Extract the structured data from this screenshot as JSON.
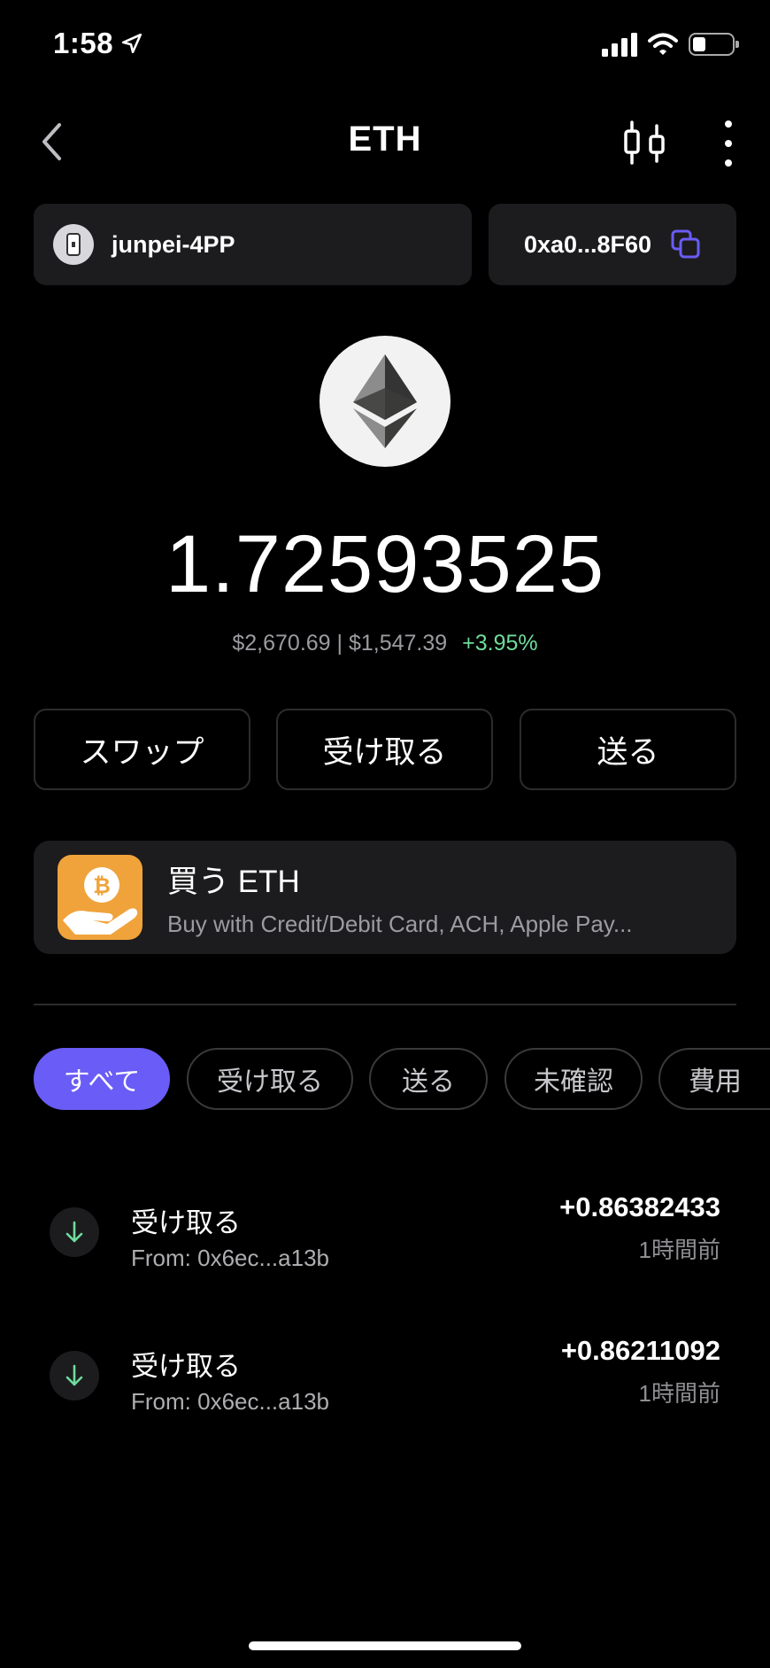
{
  "status_bar": {
    "time": "1:58"
  },
  "header": {
    "title": "ETH"
  },
  "wallet": {
    "name": "junpei-4PP",
    "address": "0xa0...8F60"
  },
  "balance": {
    "amount": "1.72593525",
    "fiat": "$2,670.69 | $1,547.39",
    "change": "+3.95%"
  },
  "actions": [
    {
      "label": "スワップ"
    },
    {
      "label": "受け取る"
    },
    {
      "label": "送る"
    }
  ],
  "buy_card": {
    "title": "買う ETH",
    "subtitle": "Buy with Credit/Debit Card, ACH, Apple Pay..."
  },
  "filters": [
    {
      "label": "すべて",
      "active": true
    },
    {
      "label": "受け取る"
    },
    {
      "label": "送る"
    },
    {
      "label": "未確認"
    },
    {
      "label": "費用"
    }
  ],
  "transactions": [
    {
      "type": "受け取る",
      "from": "From: 0x6ec...a13b",
      "amount": "+0.86382433",
      "time": "1時間前"
    },
    {
      "type": "受け取る",
      "from": "From: 0x6ec...a13b",
      "amount": "+0.86211092",
      "time": "1時間前"
    }
  ],
  "colors": {
    "accent": "#6a5cf6",
    "positive": "#6fdc9c",
    "card": "#1c1c1e",
    "buy_icon": "#f0a33a"
  }
}
